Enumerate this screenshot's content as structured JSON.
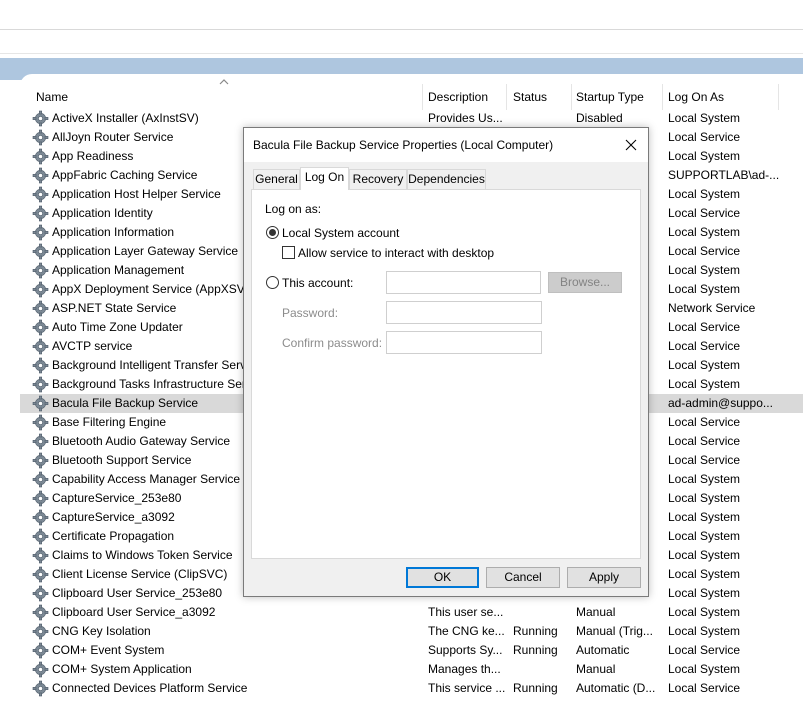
{
  "columns": {
    "name": "Name",
    "description": "Description",
    "status": "Status",
    "startup_type": "Startup Type",
    "log_on_as": "Log On As"
  },
  "services": [
    {
      "name": "ActiveX Installer (AxInstSV)",
      "description": "Provides Us...",
      "status": "",
      "startup": "Disabled",
      "logon": "Local System"
    },
    {
      "name": "AllJoyn Router Service",
      "description": "",
      "status": "",
      "startup": "",
      "logon": "Local Service"
    },
    {
      "name": "App Readiness",
      "description": "",
      "status": "",
      "startup": "",
      "logon": "Local System"
    },
    {
      "name": "AppFabric Caching Service",
      "description": "",
      "status": "",
      "startup": "",
      "logon": "SUPPORTLAB\\ad-..."
    },
    {
      "name": "Application Host Helper Service",
      "description": "",
      "status": "",
      "startup": "",
      "logon": "Local System"
    },
    {
      "name": "Application Identity",
      "description": "",
      "status": "",
      "startup": "",
      "logon": "Local Service"
    },
    {
      "name": "Application Information",
      "description": "",
      "status": "",
      "startup": "",
      "logon": "Local System"
    },
    {
      "name": "Application Layer Gateway Service",
      "description": "",
      "status": "",
      "startup": "",
      "logon": "Local Service"
    },
    {
      "name": "Application Management",
      "description": "",
      "status": "",
      "startup": "",
      "logon": "Local System"
    },
    {
      "name": "AppX Deployment Service (AppXSVC)",
      "description": "",
      "status": "",
      "startup": "",
      "logon": "Local System"
    },
    {
      "name": "ASP.NET State Service",
      "description": "",
      "status": "",
      "startup": "",
      "logon": "Network Service"
    },
    {
      "name": "Auto Time Zone Updater",
      "description": "",
      "status": "",
      "startup": "",
      "logon": "Local Service"
    },
    {
      "name": "AVCTP service",
      "description": "",
      "status": "",
      "startup": "",
      "logon": "Local Service"
    },
    {
      "name": "Background Intelligent Transfer Service",
      "description": "",
      "status": "",
      "startup": "",
      "logon": "Local System"
    },
    {
      "name": "Background Tasks Infrastructure Service",
      "description": "",
      "status": "",
      "startup": "",
      "logon": "Local System"
    },
    {
      "name": "Bacula File Backup Service",
      "description": "",
      "status": "",
      "startup": "",
      "logon": "ad-admin@suppo...",
      "selected": true
    },
    {
      "name": "Base Filtering Engine",
      "description": "",
      "status": "",
      "startup": "",
      "logon": "Local Service"
    },
    {
      "name": "Bluetooth Audio Gateway Service",
      "description": "",
      "status": "",
      "startup": "",
      "logon": "Local Service"
    },
    {
      "name": "Bluetooth Support Service",
      "description": "",
      "status": "",
      "startup": "",
      "logon": "Local Service"
    },
    {
      "name": "Capability Access Manager Service",
      "description": "",
      "status": "",
      "startup": "",
      "logon": "Local System"
    },
    {
      "name": "CaptureService_253e80",
      "description": "",
      "status": "",
      "startup": "",
      "logon": "Local System"
    },
    {
      "name": "CaptureService_a3092",
      "description": "",
      "status": "",
      "startup": "",
      "logon": "Local System"
    },
    {
      "name": "Certificate Propagation",
      "description": "",
      "status": "",
      "startup": "",
      "logon": "Local System"
    },
    {
      "name": "Claims to Windows Token Service",
      "description": "",
      "status": "",
      "startup": "",
      "logon": "Local System"
    },
    {
      "name": "Client License Service (ClipSVC)",
      "description": "",
      "status": "",
      "startup": "",
      "logon": "Local System"
    },
    {
      "name": "Clipboard User Service_253e80",
      "description": "This user se...",
      "status": "",
      "startup": "",
      "logon": "Local System"
    },
    {
      "name": "Clipboard User Service_a3092",
      "description": "This user se...",
      "status": "",
      "startup": "Manual",
      "logon": "Local System"
    },
    {
      "name": "CNG Key Isolation",
      "description": "The CNG ke...",
      "status": "Running",
      "startup": "Manual (Trig...",
      "logon": "Local System"
    },
    {
      "name": "COM+ Event System",
      "description": "Supports Sy...",
      "status": "Running",
      "startup": "Automatic",
      "logon": "Local Service"
    },
    {
      "name": "COM+ System Application",
      "description": "Manages th...",
      "status": "",
      "startup": "Manual",
      "logon": "Local System"
    },
    {
      "name": "Connected Devices Platform Service",
      "description": "This service ...",
      "status": "Running",
      "startup": "Automatic (D...",
      "logon": "Local Service"
    }
  ],
  "dialog": {
    "title": "Bacula File Backup Service Properties (Local Computer)",
    "tabs": [
      "General",
      "Log On",
      "Recovery",
      "Dependencies"
    ],
    "active_tab": "Log On",
    "log_on_as_label": "Log on as:",
    "local_system_label": "Local System account",
    "interact_label": "Allow service to interact with desktop",
    "this_account_label": "This account:",
    "password_label": "Password:",
    "confirm_password_label": "Confirm password:",
    "browse_label": "Browse...",
    "ok_label": "OK",
    "cancel_label": "Cancel",
    "apply_label": "Apply",
    "local_system_selected": true,
    "interact_checked": false
  },
  "colors": {
    "accent": "#0078d7",
    "header_band": "#aec6df",
    "selected_row": "#d9d9d9"
  }
}
